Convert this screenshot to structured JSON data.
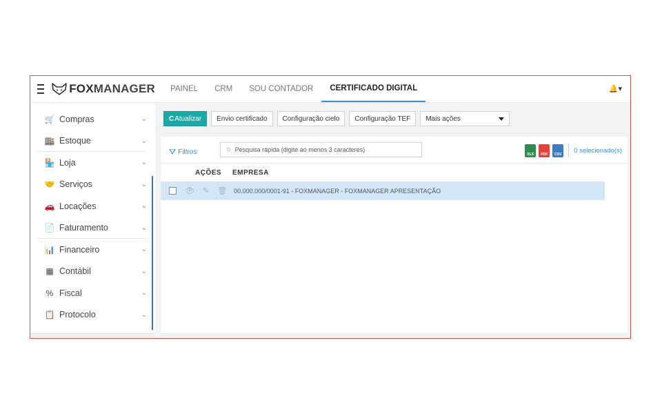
{
  "brand": {
    "name_part1": "FOX",
    "name_part2": "MANAGER"
  },
  "sidebar": {
    "items": [
      {
        "label": "Compras",
        "icon": "cart-icon",
        "glyph": "🛒"
      },
      {
        "label": "Estoque",
        "icon": "warehouse-icon",
        "glyph": "🏬"
      },
      {
        "label": "Loja",
        "icon": "store-icon",
        "glyph": "🏪"
      },
      {
        "label": "Serviços",
        "icon": "handshake-icon",
        "glyph": "🤝"
      },
      {
        "label": "Locações",
        "icon": "rental-icon",
        "glyph": "🚗"
      },
      {
        "label": "Faturamento",
        "icon": "invoice-icon",
        "glyph": "📄"
      },
      {
        "label": "Financeiro",
        "icon": "finance-chart-icon",
        "glyph": "📊"
      },
      {
        "label": "Contábil",
        "icon": "accounting-icon",
        "glyph": "▦"
      },
      {
        "label": "Fiscal",
        "icon": "percent-icon",
        "glyph": "%"
      },
      {
        "label": "Protocolo",
        "icon": "protocol-icon",
        "glyph": "📋"
      }
    ]
  },
  "topnav": {
    "tabs": [
      {
        "label": "PAINEL"
      },
      {
        "label": "CRM"
      },
      {
        "label": "SOU CONTADOR"
      },
      {
        "label": "CERTIFICADO DIGITAL",
        "active": true
      }
    ]
  },
  "toolbar": {
    "refresh_label": "Atualizar",
    "send_cert_label": "Envio certificado",
    "cielo_label": "Configuração cielo",
    "tef_label": "Configuração TEF",
    "more_actions_label": "Mais ações"
  },
  "list": {
    "filters_label": "Filtros",
    "search_placeholder": "Pesquisa rápida (digite ao menos 3 caracteres)",
    "export_xls": "XLS",
    "export_pdf": "PDF",
    "export_csv": "CSV",
    "selected_count": "0 selecionado(s)",
    "col_actions": "AÇÕES",
    "col_company": "EMPRESA",
    "rows": [
      {
        "company": "00.000.000/0001-91 - FOXMANAGER - FOXMANAGER APRESENTAÇÃO"
      }
    ]
  },
  "colors": {
    "accent": "#1aa9a6",
    "link": "#3b8ed4",
    "row_selected": "#d3e6f7",
    "frame_border": "#d9534f"
  }
}
